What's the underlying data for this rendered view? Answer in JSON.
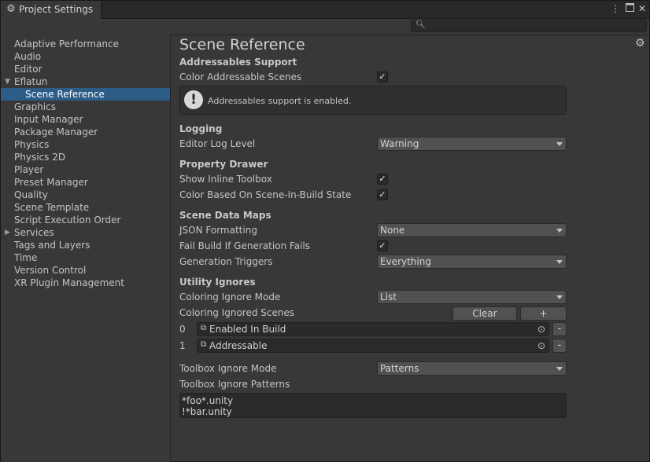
{
  "window": {
    "tab_title": "Project Settings",
    "tab_icon": "gear-icon"
  },
  "search": {
    "placeholder": ""
  },
  "sidebar": {
    "items": [
      {
        "label": "Adaptive Performance"
      },
      {
        "label": "Audio"
      },
      {
        "label": "Editor"
      },
      {
        "label": "Eflatun",
        "expanded": true
      },
      {
        "label": "Scene Reference",
        "selected": true
      },
      {
        "label": "Graphics"
      },
      {
        "label": "Input Manager"
      },
      {
        "label": "Package Manager"
      },
      {
        "label": "Physics"
      },
      {
        "label": "Physics 2D"
      },
      {
        "label": "Player"
      },
      {
        "label": "Preset Manager"
      },
      {
        "label": "Quality"
      },
      {
        "label": "Scene Template"
      },
      {
        "label": "Script Execution Order"
      },
      {
        "label": "Services",
        "expanded": false
      },
      {
        "label": "Tags and Layers"
      },
      {
        "label": "Time"
      },
      {
        "label": "Version Control"
      },
      {
        "label": "XR Plugin Management"
      }
    ]
  },
  "main": {
    "title": "Scene Reference",
    "addressables": {
      "header": "Addressables Support",
      "color_label": "Color Addressable Scenes",
      "color_checked": true,
      "help_text": "Addressables support is enabled."
    },
    "logging": {
      "header": "Logging",
      "level_label": "Editor Log Level",
      "level_value": "Warning"
    },
    "property_drawer": {
      "header": "Property Drawer",
      "inline_label": "Show Inline Toolbox",
      "inline_checked": true,
      "color_label": "Color Based On Scene-In-Build State",
      "color_checked": true
    },
    "data_maps": {
      "header": "Scene Data Maps",
      "json_label": "JSON Formatting",
      "json_value": "None",
      "fail_label": "Fail Build If Generation Fails",
      "fail_checked": true,
      "triggers_label": "Generation Triggers",
      "triggers_value": "Everything"
    },
    "utility_ignores": {
      "header": "Utility Ignores",
      "coloring_mode_label": "Coloring Ignore Mode",
      "coloring_mode_value": "List",
      "ignored_scenes_label": "Coloring Ignored Scenes",
      "clear_label": "Clear",
      "add_label": "+",
      "scenes": [
        {
          "index": "0",
          "name": "Enabled In Build"
        },
        {
          "index": "1",
          "name": "Addressable"
        }
      ],
      "remove_label": "-",
      "toolbox_mode_label": "Toolbox Ignore Mode",
      "toolbox_mode_value": "Patterns",
      "patterns_label": "Toolbox Ignore Patterns",
      "patterns": [
        "*foo*.unity",
        "!*bar.unity"
      ]
    }
  }
}
